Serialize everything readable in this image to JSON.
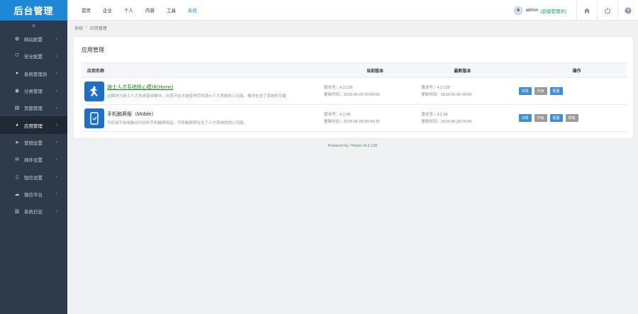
{
  "sidebar": {
    "logo": "后台管理",
    "collapse_icon": "≡",
    "items": [
      {
        "label": "网站配置",
        "icon": "gear-icon",
        "glyph": "✿"
      },
      {
        "label": "安全配置",
        "icon": "shield-icon",
        "glyph": "⛉"
      },
      {
        "label": "系统管理员",
        "icon": "user-icon",
        "glyph": "●"
      },
      {
        "label": "分类管理",
        "icon": "category-icon",
        "glyph": "◉"
      },
      {
        "label": "页面管理",
        "icon": "page-icon",
        "glyph": "▤"
      },
      {
        "label": "应用管理",
        "icon": "app-icon",
        "glyph": "◕",
        "active": true
      },
      {
        "label": "营销设置",
        "icon": "paper-plane-icon",
        "glyph": "➤"
      },
      {
        "label": "邮件设置",
        "icon": "mail-icon",
        "glyph": "✉"
      },
      {
        "label": "短信设置",
        "icon": "mobile-icon",
        "glyph": "▯"
      },
      {
        "label": "微信平台",
        "icon": "wechat-icon",
        "glyph": "☁"
      },
      {
        "label": "系统日志",
        "icon": "log-icon",
        "glyph": "▥"
      }
    ]
  },
  "topbar": {
    "nav": [
      "首页",
      "企业",
      "个人",
      "内容",
      "工具",
      "系统"
    ],
    "active_nav": "系统",
    "admin_name": "admin",
    "admin_role": "(超级管理员)",
    "icons": [
      "home-icon",
      "power-icon",
      "help-icon"
    ]
  },
  "breadcrumb": [
    "系统",
    "应用管理"
  ],
  "panel": {
    "title": "应用管理",
    "columns": [
      "应用名称",
      "当前版本",
      "最新版本",
      "操作"
    ],
    "rows": [
      {
        "name": "骑士人才系统核心模块(Home)",
        "desc": "此模块为骑士人才系统基础模块，必须开启才能使用您的骑士人才系统核心功能，模块包含了系统的功能",
        "current_version": "版本号：4.2.128",
        "current_time": "更新时间：2018-09-06 09:09:09",
        "latest_version": "版本号：4.2.128",
        "latest_time": "更新时间：2018-09-06 09:09",
        "buttons": [
          {
            "label": "详情",
            "style": "blue"
          },
          {
            "label": "升级",
            "style": "gray"
          },
          {
            "label": "配置",
            "style": "blue"
          }
        ]
      },
      {
        "name": "手机触屏版（Mobile）",
        "desc": "手机或平板电脑访问您的手机触屏网站，手机触屏版包含了人才系统的核心功能。",
        "current_version": "版本号：4.2.98",
        "current_time": "更新时间：2018-08-28 09:49:25",
        "latest_version": "版本号：4.2.98",
        "latest_time": "更新时间：2018-08-28 09:49",
        "buttons": [
          {
            "label": "详情",
            "style": "blue"
          },
          {
            "label": "升级",
            "style": "gray"
          },
          {
            "label": "配置",
            "style": "blue"
          },
          {
            "label": "卸载",
            "style": "gray"
          }
        ]
      }
    ]
  },
  "footer": {
    "prefix": "Powered by ",
    "brand": "74cms",
    "version": " v4.2.128"
  }
}
